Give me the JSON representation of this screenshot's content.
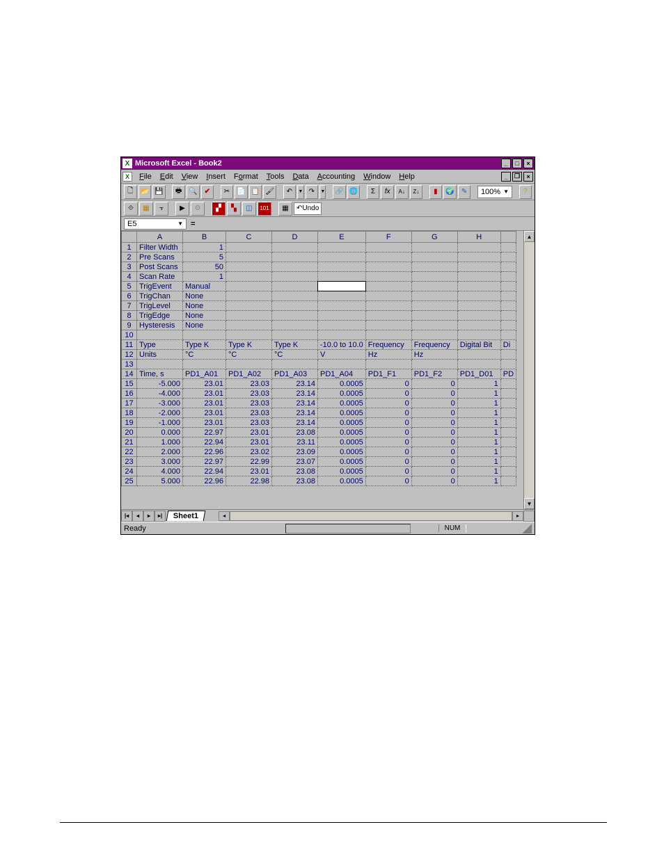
{
  "window": {
    "app_title": "Microsoft Excel - Book2",
    "min_label": "_",
    "max_label": "□",
    "close_label": "×"
  },
  "menu": {
    "items": [
      {
        "label": "File",
        "u": "F"
      },
      {
        "label": "Edit",
        "u": "E"
      },
      {
        "label": "View",
        "u": "V"
      },
      {
        "label": "Insert",
        "u": "I"
      },
      {
        "label": "Format",
        "u": "o"
      },
      {
        "label": "Tools",
        "u": "T"
      },
      {
        "label": "Data",
        "u": "D"
      },
      {
        "label": "Accounting",
        "u": "A"
      },
      {
        "label": "Window",
        "u": "W"
      },
      {
        "label": "Help",
        "u": "H"
      }
    ]
  },
  "toolbar1": {
    "zoom": "100%"
  },
  "toolbar2": {
    "undo_label": "Undo"
  },
  "formula": {
    "namebox": "E5",
    "value": ""
  },
  "grid": {
    "columns": [
      "A",
      "B",
      "C",
      "D",
      "E",
      "F",
      "G",
      "H",
      ""
    ],
    "selected": {
      "row": 5,
      "col": "E"
    },
    "rows": [
      {
        "n": 1,
        "A": "Filter Width",
        "B": "1",
        "Balign": "r"
      },
      {
        "n": 2,
        "A": "Pre Scans",
        "B": "5",
        "Balign": "r"
      },
      {
        "n": 3,
        "A": "Post Scans",
        "B": "50",
        "Balign": "r"
      },
      {
        "n": 4,
        "A": "Scan Rate",
        "B": "1",
        "Balign": "r"
      },
      {
        "n": 5,
        "A": "TrigEvent",
        "B": "Manual"
      },
      {
        "n": 6,
        "A": "TrigChan",
        "B": "None"
      },
      {
        "n": 7,
        "A": "TrigLevel",
        "B": "None"
      },
      {
        "n": 8,
        "A": "TrigEdge",
        "B": "None"
      },
      {
        "n": 9,
        "A": "Hysteresis",
        "B": "None"
      },
      {
        "n": 10
      },
      {
        "n": 11,
        "A": "Type",
        "B": "Type K",
        "C": "Type K",
        "D": "Type K",
        "E": "-10.0 to 10.0",
        "F": "Frequency",
        "G": "Frequency",
        "H": "Digital Bit",
        "I": "Di"
      },
      {
        "n": 12,
        "A": "Units",
        "B": "°C",
        "C": "°C",
        "D": "°C",
        "E": "V",
        "F": "Hz",
        "G": "Hz"
      },
      {
        "n": 13
      },
      {
        "n": 14,
        "A": "Time, s",
        "B": "PD1_A01",
        "C": "PD1_A02",
        "D": "PD1_A03",
        "E": "PD1_A04",
        "F": "PD1_F1",
        "G": "PD1_F2",
        "H": "PD1_D01",
        "I": "PD"
      },
      {
        "n": 15,
        "A": "-5.000",
        "B": "23.01",
        "C": "23.03",
        "D": "23.14",
        "E": "0.0005",
        "F": "0",
        "G": "0",
        "H": "1",
        "num": true
      },
      {
        "n": 16,
        "A": "-4.000",
        "B": "23.01",
        "C": "23.03",
        "D": "23.14",
        "E": "0.0005",
        "F": "0",
        "G": "0",
        "H": "1",
        "num": true
      },
      {
        "n": 17,
        "A": "-3.000",
        "B": "23.01",
        "C": "23.03",
        "D": "23.14",
        "E": "0.0005",
        "F": "0",
        "G": "0",
        "H": "1",
        "num": true
      },
      {
        "n": 18,
        "A": "-2.000",
        "B": "23.01",
        "C": "23.03",
        "D": "23.14",
        "E": "0.0005",
        "F": "0",
        "G": "0",
        "H": "1",
        "num": true
      },
      {
        "n": 19,
        "A": "-1.000",
        "B": "23.01",
        "C": "23.03",
        "D": "23.14",
        "E": "0.0005",
        "F": "0",
        "G": "0",
        "H": "1",
        "num": true
      },
      {
        "n": 20,
        "A": "0.000",
        "B": "22.97",
        "C": "23.01",
        "D": "23.08",
        "E": "0.0005",
        "F": "0",
        "G": "0",
        "H": "1",
        "num": true
      },
      {
        "n": 21,
        "A": "1.000",
        "B": "22.94",
        "C": "23.01",
        "D": "23.11",
        "E": "0.0005",
        "F": "0",
        "G": "0",
        "H": "1",
        "num": true
      },
      {
        "n": 22,
        "A": "2.000",
        "B": "22.96",
        "C": "23.02",
        "D": "23.09",
        "E": "0.0005",
        "F": "0",
        "G": "0",
        "H": "1",
        "num": true
      },
      {
        "n": 23,
        "A": "3.000",
        "B": "22.97",
        "C": "22.99",
        "D": "23.07",
        "E": "0.0005",
        "F": "0",
        "G": "0",
        "H": "1",
        "num": true
      },
      {
        "n": 24,
        "A": "4.000",
        "B": "22.94",
        "C": "23.01",
        "D": "23.08",
        "E": "0.0005",
        "F": "0",
        "G": "0",
        "H": "1",
        "num": true
      },
      {
        "n": 25,
        "A": "5.000",
        "B": "22.96",
        "C": "22.98",
        "D": "23.08",
        "E": "0.0005",
        "F": "0",
        "G": "0",
        "H": "1",
        "num": true
      }
    ]
  },
  "tabs": {
    "sheet1": "Sheet1"
  },
  "status": {
    "ready": "Ready",
    "num": "NUM"
  }
}
